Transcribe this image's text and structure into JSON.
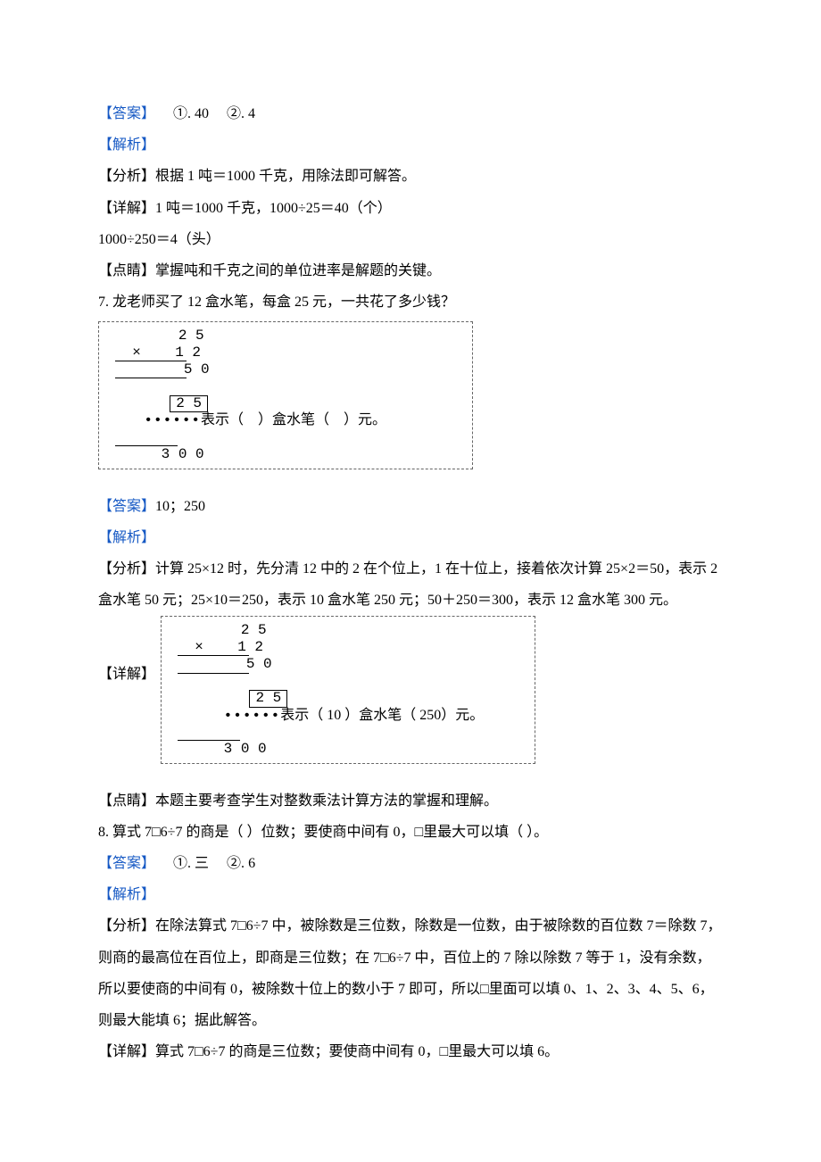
{
  "labels": {
    "answer": "【答案】",
    "explain": "【解析】",
    "analysis": "【分析】",
    "detail": "【详解】",
    "dianjing": "【点睛】",
    "circle1": "①. ",
    "circle2": "②. "
  },
  "sec6": {
    "ans1": "40",
    "ans2": "4",
    "analysis": "根据 1 吨＝1000 千克，用除法即可解答。",
    "detail": "1 吨＝1000 千克，1000÷25＝40（个）",
    "detail_line2": "1000÷250＝4（头）",
    "dianjing": "掌握吨和千克之间的单位进率是解题的关键。"
  },
  "q7": {
    "number": "7. ",
    "question": "龙老师买了 12 盒水笔，每盒 25 元，一共花了多少钱？",
    "calc": {
      "r1": "        2 5",
      "r2": "  ×    1 2",
      "r3": "        5 0",
      "r4_box": "2 5",
      "dots": "••••••",
      "label_tpl_pre": "表示（",
      "label_blank": "    ",
      "label_mid": "）盒水笔（",
      "label_end": "）元。",
      "r5": "      3 0 0"
    },
    "answer": "10；250",
    "analysis": "计算 25×12 时，先分清 12 中的 2 在个位上，1 在十位上，接着依次计算 25×2＝50，表示 2 盒水笔 50 元；25×10＝250，表示 10 盒水笔 250 元；50＋250＝300，表示 12 盒水笔 300 元。",
    "detail_fill1": " 10 ",
    "detail_fill2": " 250",
    "dianjing": "本题主要考查学生对整数乘法计算方法的掌握和理解。"
  },
  "q8": {
    "number": "8. ",
    "question_pre": "算式 7□6÷7 的商是（        ）位数；要使商中间有 0，□里最大可以填（        ）。",
    "ans1": "三",
    "ans2": "6",
    "analysis": "在除法算式 7□6÷7 中，被除数是三位数，除数是一位数，由于被除数的百位数 7＝除数 7，则商的最高位在百位上，即商是三位数；在 7□6÷7 中，百位上的 7 除以除数 7 等于 1，没有余数，所以要使商的中间有 0，被除数十位上的数小于 7 即可，所以□里面可以填 0、1、2、3、4、5、6，则最大能填 6；据此解答。",
    "detail": "算式 7□6÷7 的商是三位数；要使商中间有 0，□里最大可以填 6。"
  }
}
